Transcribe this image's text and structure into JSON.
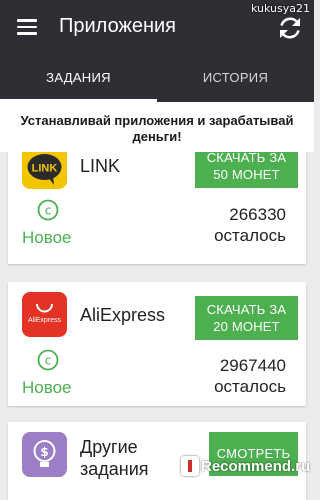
{
  "header": {
    "title": "Приложения",
    "menu_icon": "hamburger-menu-icon",
    "refresh_icon": "refresh-icon",
    "username": "kukusya21"
  },
  "tabs": [
    {
      "label": "ЗАДАНИЯ",
      "active": true
    },
    {
      "label": "ИСТОРИЯ",
      "active": false
    }
  ],
  "banner": {
    "line1": "Устанавливай приложения и зарабатывай",
    "line2": "деньги!"
  },
  "offers": [
    {
      "name": "LINK",
      "cta_line1": "СКАЧАТЬ ЗА",
      "cta_line2": "50 МОНЕТ",
      "status": "Новое",
      "count": "266330",
      "count_label": "осталось",
      "icon": "line-app-icon",
      "icon_color": "#f3c400"
    },
    {
      "name": "AliExpress",
      "cta_line1": "СКАЧАТЬ ЗА",
      "cta_line2": "20 МОНЕТ",
      "status": "Новое",
      "count": "2967440",
      "count_label": "осталось",
      "icon": "aliexpress-app-icon",
      "icon_text": "AliExpress",
      "icon_color": "#e43225"
    },
    {
      "name_line1": "Другие",
      "name_line2": "задания",
      "cta": "СМОТРЕТЬ",
      "icon": "other-tasks-icon",
      "icon_color": "#9c7ec6"
    }
  ],
  "colors": {
    "appbar": "#2e2e34",
    "accent_green": "#4caf50",
    "background": "#ececec"
  },
  "watermark": {
    "text": "Recommend.ru",
    "icon": "irecommend-logo-icon"
  }
}
